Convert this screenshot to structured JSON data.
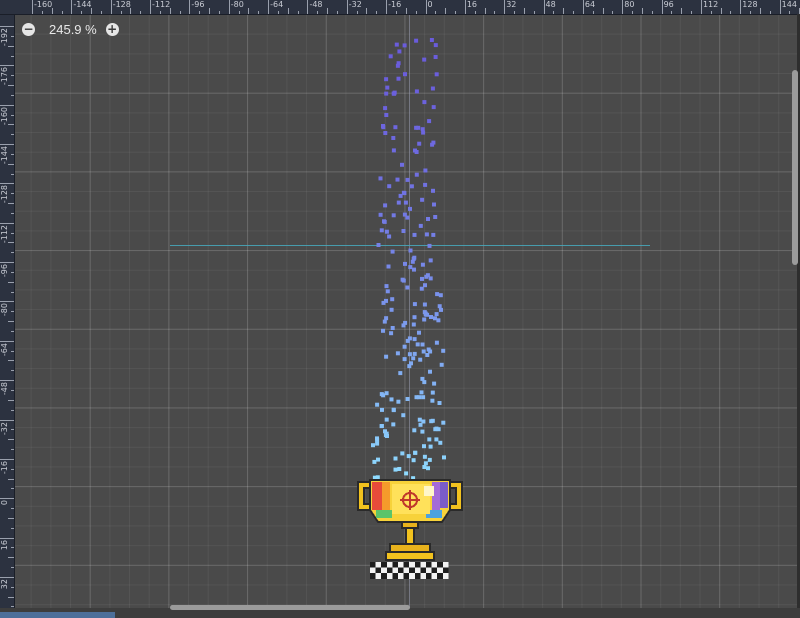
{
  "editor": {
    "zoom": {
      "label": "245.9 %",
      "zoom_out_icon": "minus-circle-icon",
      "zoom_in_icon": "plus-circle-icon",
      "zoom_out_glyph": "−",
      "zoom_in_glyph": "+"
    },
    "ruler": {
      "horizontal_labels": [
        "-160",
        "-144",
        "-128",
        "-112",
        "-96",
        "-80",
        "-64",
        "-48",
        "-32",
        "-16",
        "0",
        "16",
        "32",
        "48",
        "64",
        "80",
        "96",
        "112",
        "128",
        "144"
      ],
      "vertical_labels": [
        "-192",
        "-176",
        "-160",
        "-144",
        "-128",
        "-112",
        "-96",
        "-80",
        "-64",
        "-48",
        "-32",
        "-16",
        "0",
        "16",
        "32"
      ]
    },
    "scene": {
      "particle_color_top": "#6a5cdc",
      "particle_color_bottom": "#8fdcff",
      "trophy_icon": "trophy-icon",
      "guide_line_color": "#46aabe"
    }
  }
}
